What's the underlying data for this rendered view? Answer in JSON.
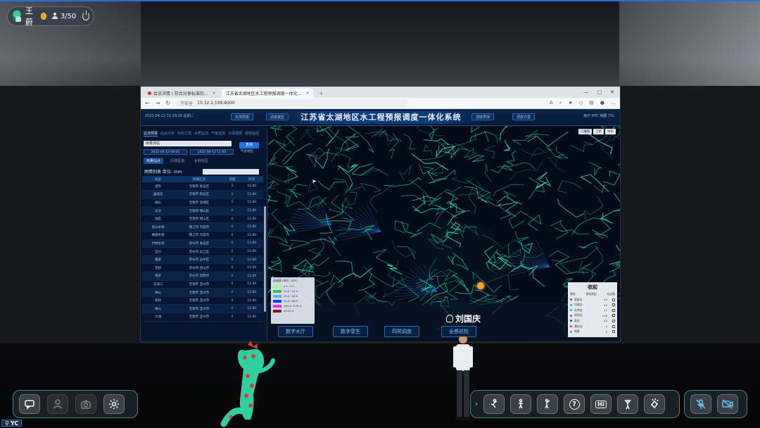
{
  "session": {
    "user_name": "王蔚",
    "participant_count": "3/50",
    "corner_tag": "YC"
  },
  "browser": {
    "tabs": [
      {
        "label": "会议详情 | 符合分享标准的..."
      },
      {
        "label": "江苏省太湖地区水工程预报调度一体化..."
      }
    ],
    "security_label": "不安全",
    "url": "10.32.2.199:8000"
  },
  "app": {
    "title": "江苏省太湖地区水工程预报调度一体化系统",
    "datetime": "2022-04-12  11:19:19  星期二",
    "header_left_buttons": [
      "实测预报",
      "调度模型"
    ],
    "header_right_buttons": [
      "调度预演",
      "调度方案"
    ],
    "header_user": "用户  HYC  地图  7YL",
    "left_tabs": [
      "监测预报",
      "站点分布",
      "实时工情",
      "水质监测",
      "气象监测",
      "水情视频",
      "视频监控"
    ],
    "active_left_tab": "监测预报",
    "station_select": "雨量测站",
    "query_button": "查询",
    "date_from": "2022-04-12 08:00",
    "date_to": "2022-04-12 11:00",
    "check_label": "不含地区",
    "sub_tabs": [
      "雨量站点",
      "行政区划",
      "水利分区"
    ],
    "list_title": "雨情列表  单位: mm",
    "table_headers": [
      "站名",
      "所属区县",
      "雨量",
      "时间"
    ],
    "table_rows": [
      [
        "望亭",
        "无锡市 新吴区",
        "0",
        "11:00"
      ],
      [
        "蠡城北",
        "无锡市 新吴区",
        "0",
        "11:00"
      ],
      [
        "湖山",
        "无锡市 滨湖区",
        "0",
        "11:00"
      ],
      [
        "东亭",
        "无锡市 锡山区",
        "0",
        "11:00"
      ],
      [
        "陆区",
        "无锡市 锡山区",
        "0",
        "11:00"
      ],
      [
        "后山水库",
        "镇江市 句容市",
        "0",
        "11:00"
      ],
      [
        "横塘水库",
        "镇江市 句容市",
        "0",
        "11:00"
      ],
      [
        "竹林水库",
        "常州市 金坛区",
        "0",
        "11:00"
      ],
      [
        "宜兴",
        "苏州市 吴江区",
        "0",
        "11:00"
      ],
      [
        "藕渠",
        "苏州市 吴中区",
        "0",
        "11:00"
      ],
      [
        "花桥",
        "苏州市 昆山市",
        "0",
        "11:00"
      ],
      [
        "梅李",
        "苏州市 常熟市",
        "0",
        "11:00"
      ],
      [
        "双溪口",
        "无锡市 宜兴市",
        "0",
        "11:00"
      ],
      [
        "钟山",
        "无锡市 宜兴市",
        "0",
        "11:00"
      ],
      [
        "和桥",
        "无锡市 宜兴市",
        "0",
        "11:00"
      ],
      [
        "横山",
        "无锡市 宜兴市",
        "0",
        "11:00"
      ],
      [
        "大浦",
        "无锡市 宜兴市",
        "0",
        "11:00"
      ]
    ],
    "map_layers": [
      "二维图",
      "卫星",
      "地形"
    ],
    "map_buttons": [
      "数字水厅",
      "数字孪生",
      "四预调度",
      "全景巡检"
    ],
    "legend_title": "雨量图  (单位: mm)",
    "legend_items": [
      {
        "label": "0.1~9.9",
        "color": "#a6f3a6"
      },
      {
        "label": "10.0~24.9",
        "color": "#3fbf3f"
      },
      {
        "label": "25.0~49.9",
        "color": "#5fb6f2"
      },
      {
        "label": "50.0~99.9",
        "color": "#1a3cf0"
      },
      {
        "label": "100.0~249.9",
        "color": "#f031f0"
      },
      {
        "label": "≥250.0",
        "color": "#7a1a1a"
      }
    ],
    "right_panel_title": "收起",
    "right_panel_headers": [
      "图例",
      "测站类型",
      "站点数"
    ],
    "right_panel_rows": [
      {
        "label": "雨量站",
        "count": "44",
        "color": "#2a62d6"
      },
      {
        "label": "河道站",
        "count": "40",
        "color": "#1ea0e6"
      },
      {
        "label": "水库站",
        "count": "17",
        "color": "#2dbf66"
      },
      {
        "label": "闸坝站",
        "count": "118",
        "color": "#7a3fd6"
      },
      {
        "label": "泵站",
        "count": "43",
        "color": "#1e3a8a"
      },
      {
        "label": "潮位站",
        "count": "4",
        "color": "#d6402a"
      },
      {
        "label": "墒情",
        "count": "0",
        "color": "#888888"
      }
    ]
  },
  "floating_name": "刘国庆",
  "toolbars": {
    "left": [
      {
        "name": "chat",
        "label": "chat-bubble-icon"
      },
      {
        "name": "user",
        "label": "user-icon"
      },
      {
        "name": "camera",
        "label": "camera-icon"
      },
      {
        "name": "settings",
        "label": "gear-icon"
      }
    ],
    "gestures": [
      {
        "name": "gesture-1"
      },
      {
        "name": "gesture-2"
      },
      {
        "name": "gesture-3"
      },
      {
        "name": "question",
        "text": "?"
      },
      {
        "name": "hi",
        "text": "HI"
      },
      {
        "name": "cheer"
      },
      {
        "name": "clap"
      }
    ],
    "media": [
      {
        "name": "mic-off"
      },
      {
        "name": "camera-off"
      }
    ]
  },
  "colors": {
    "accent": "#2a6fd6",
    "map_lines": "#2be0a8",
    "map_bg": "#030b1a"
  }
}
